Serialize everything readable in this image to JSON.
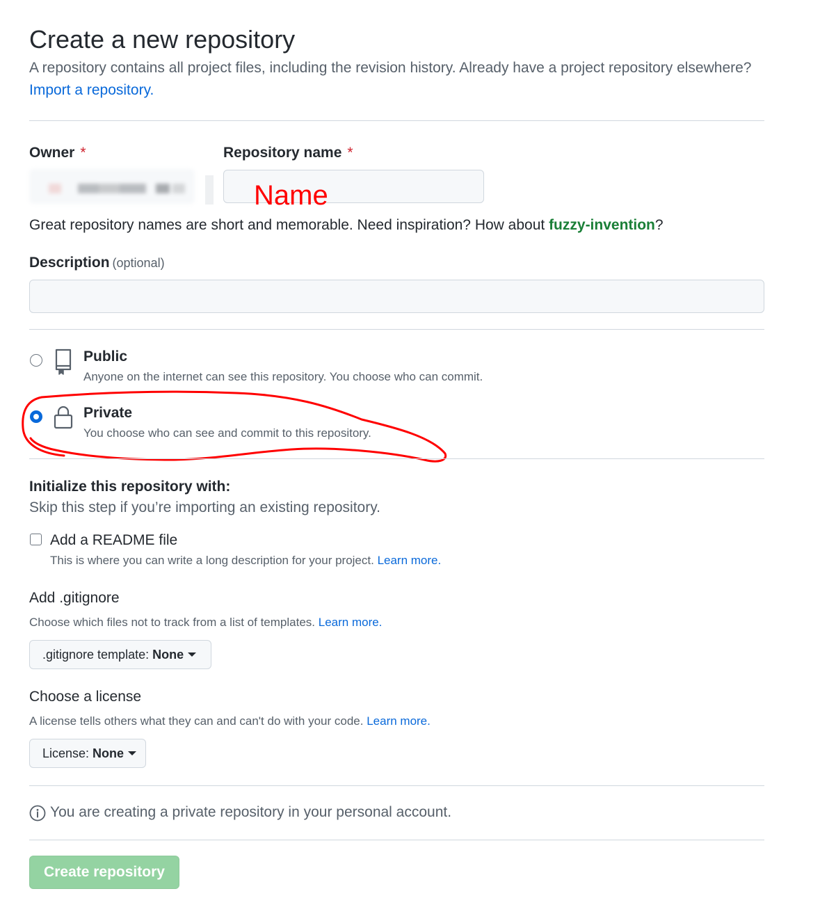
{
  "header": {
    "title": "Create a new repository",
    "subtitle": "A repository contains all project files, including the revision history. Already have a project repository elsewhere?",
    "import_link": "Import a repository."
  },
  "owner": {
    "label": "Owner",
    "required_mark": "*"
  },
  "repo_name": {
    "label": "Repository name",
    "required_mark": "*",
    "value": "",
    "overlay_annotation": "Name"
  },
  "name_hint": {
    "text": "Great repository names are short and memorable. Need inspiration? How about ",
    "suggestion": "fuzzy-invention",
    "suffix": "?"
  },
  "description": {
    "label": "Description",
    "optional": "(optional)",
    "value": ""
  },
  "visibility": {
    "selected": "private",
    "public": {
      "title": "Public",
      "desc": "Anyone on the internet can see this repository. You choose who can commit."
    },
    "private": {
      "title": "Private",
      "desc": "You choose who can see and commit to this repository."
    }
  },
  "initialize": {
    "title": "Initialize this repository with:",
    "desc": "Skip this step if you’re importing an existing repository.",
    "readme": {
      "label": "Add a README file",
      "checked": false,
      "desc": "This is where you can write a long description for your project.",
      "learn_more": "Learn more."
    }
  },
  "gitignore": {
    "title": "Add .gitignore",
    "desc": "Choose which files not to track from a list of templates.",
    "learn_more": "Learn more.",
    "button_prefix": ".gitignore template:",
    "button_value": "None"
  },
  "license": {
    "title": "Choose a license",
    "desc": "A license tells others what they can and can't do with your code.",
    "learn_more": "Learn more.",
    "button_prefix": "License:",
    "button_value": "None"
  },
  "info_notice": "You are creating a private repository in your personal account.",
  "submit": {
    "label": "Create repository",
    "disabled": true
  },
  "colors": {
    "link": "#0969da",
    "suggestion": "#1a7f37",
    "required": "#cf222e",
    "submit_disabled_bg": "#94d3a2",
    "annotation_red": "#ff0000"
  }
}
